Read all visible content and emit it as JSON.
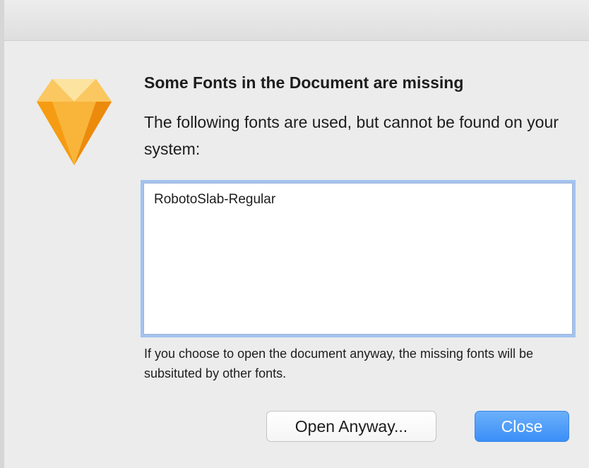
{
  "dialog": {
    "title": "Some Fonts in the Document are missing",
    "message": "The following fonts are used, but cannot be found on your system:",
    "missing_fonts": [
      "RobotoSlab-Regular"
    ],
    "note": "If you choose to open the document anyway, the missing fonts will be subsituted by other fonts.",
    "icon": "sketch-diamond-icon"
  },
  "buttons": {
    "open_anyway": "Open Anyway...",
    "close": "Close"
  },
  "colors": {
    "accent": "#3b8ef7",
    "focus_ring": "#a3c3f0",
    "icon_orange": "#f7a21b"
  }
}
